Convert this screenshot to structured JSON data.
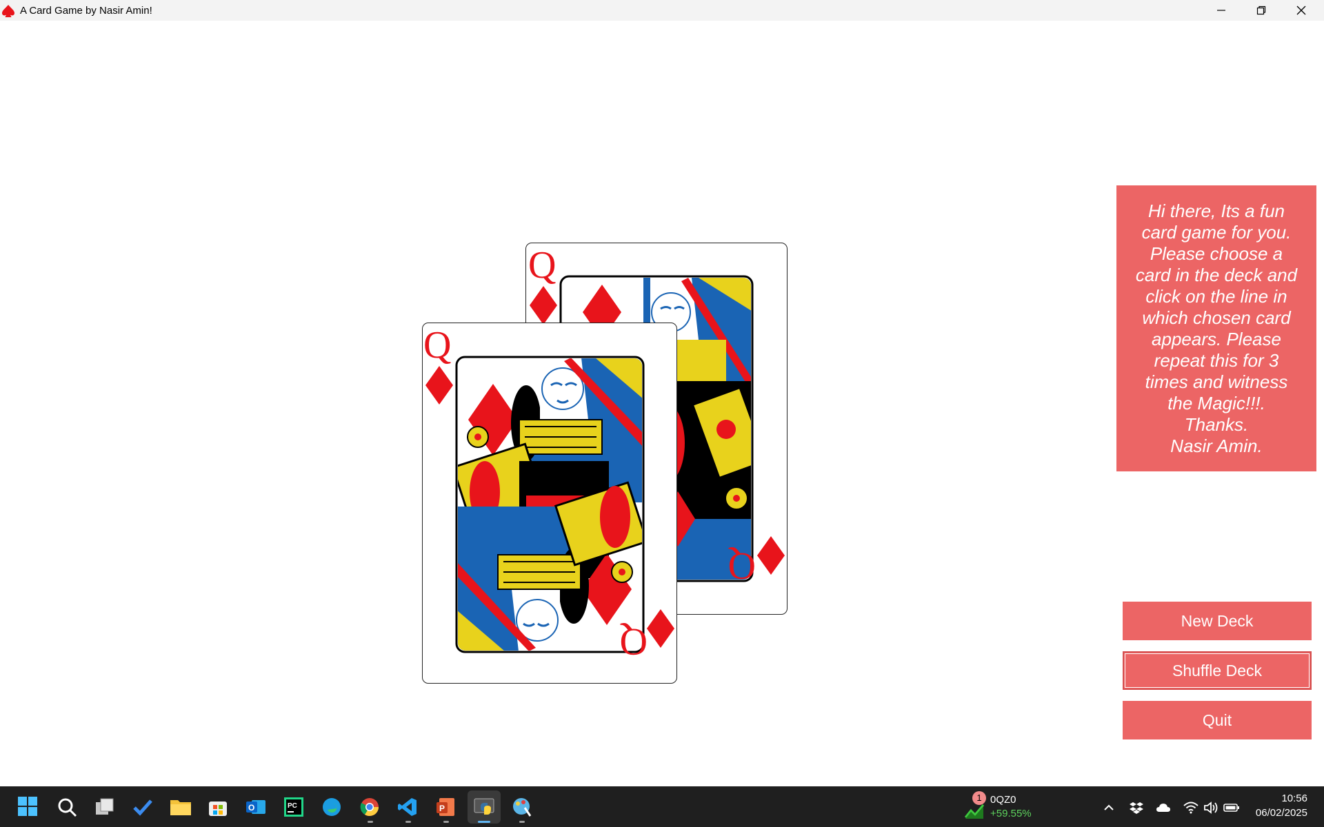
{
  "window": {
    "title": "A Card Game by Nasir Amin!",
    "icon": "spade-icon"
  },
  "cards": [
    {
      "rank": "Q",
      "suit": "diamonds",
      "suit_symbol": "♦",
      "color": "#e8141b"
    },
    {
      "rank": "Q",
      "suit": "diamonds",
      "suit_symbol": "♦",
      "color": "#e8141b"
    }
  ],
  "info_panel": {
    "lines": [
      "Hi there, Its a fun",
      "card game for you.",
      "Please choose a",
      "card in the deck and",
      "click on the line in",
      "which chosen card",
      "appears. Please",
      "repeat this for 3",
      "times and witness",
      "the Magic!!!.",
      "Thanks.",
      "Nasir Amin."
    ]
  },
  "buttons": {
    "new_deck": "New Deck",
    "shuffle_deck": "Shuffle Deck",
    "quit": "Quit"
  },
  "taskbar": {
    "apps": [
      "windows-start-icon",
      "search-icon",
      "task-view-icon",
      "todo-icon",
      "file-explorer-icon",
      "store-icon",
      "outlook-icon",
      "pycharm-icon",
      "edge-icon",
      "chrome-icon",
      "vscode-icon",
      "powerpoint-icon",
      "python-icon",
      "paint-icon"
    ],
    "stock": {
      "badge": "1",
      "name": "0QZ0",
      "change": "+59.55%"
    },
    "clock": {
      "time": "10:56",
      "date": "06/02/2025"
    }
  },
  "colors": {
    "accent": "#ec6565",
    "card_red": "#e8141b",
    "taskbar": "#1f1f1f"
  }
}
